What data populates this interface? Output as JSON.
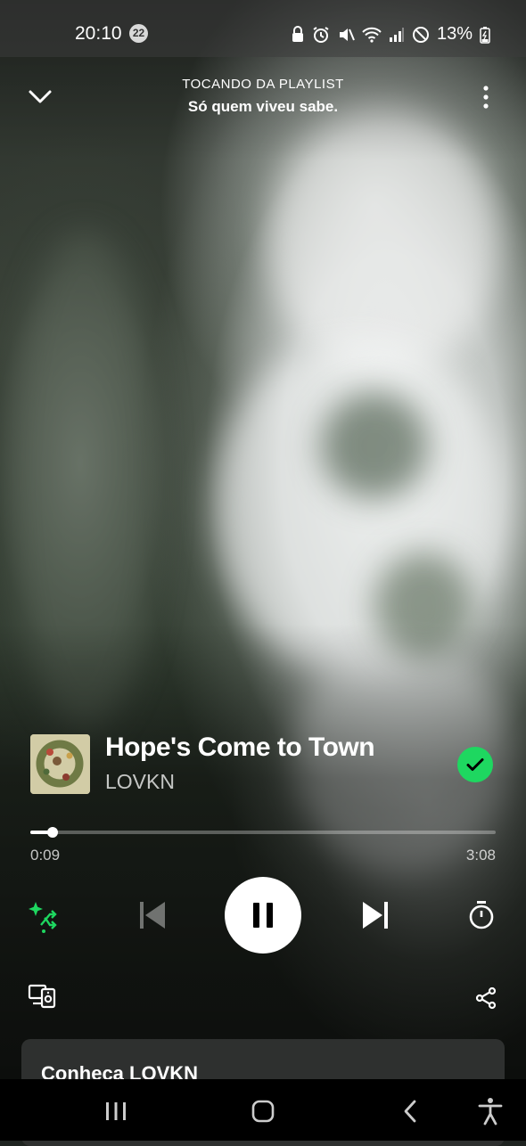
{
  "status_bar": {
    "time": "20:10",
    "notification_count": "22",
    "battery": "13%"
  },
  "header": {
    "context_label": "TOCANDO DA PLAYLIST",
    "playlist_name": "Só quem viveu sabe."
  },
  "track": {
    "title": "Hope's Come to Town",
    "artist": "LOVKN",
    "liked": true
  },
  "playback": {
    "elapsed": "0:09",
    "duration": "3:08",
    "progress_fraction": 0.048,
    "state": "playing"
  },
  "artist_card": {
    "title": "Conheça LOVKN"
  },
  "colors": {
    "accent": "#1ed760",
    "background_dark": "#1e2320"
  },
  "icons": {
    "collapse": "chevron-down-icon",
    "more": "more-vertical-icon",
    "liked": "check-circle-icon",
    "shuffle": "smart-shuffle-icon",
    "prev": "skip-previous-icon",
    "pause": "pause-icon",
    "next": "skip-next-icon",
    "timer": "sleep-timer-icon",
    "devices": "connect-device-icon",
    "share": "share-icon"
  }
}
